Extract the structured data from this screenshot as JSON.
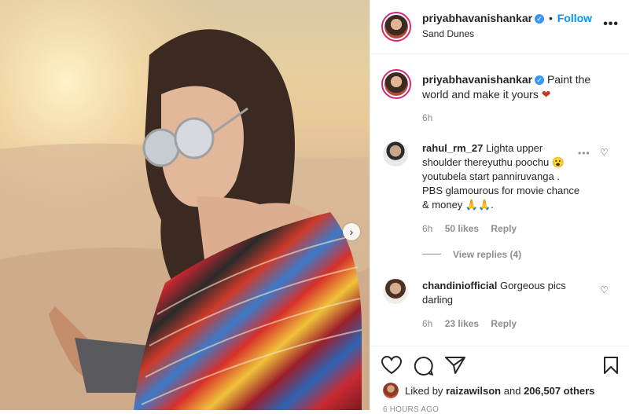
{
  "header": {
    "username": "priyabhavanishankar",
    "verified_icon": "✓",
    "separator": "•",
    "follow_label": "Follow",
    "location": "Sand Dunes",
    "more_icon": "•••"
  },
  "caption": {
    "username": "priyabhavanishankar",
    "text": "Paint the world and make it yours",
    "heart": "❤",
    "time": "6h"
  },
  "comments": [
    {
      "username": "rahul_rm_27",
      "lines": [
        "Lighta upper",
        "shoulder thereyuthu poochu 😮",
        "youtubela start panniruvanga .",
        "PBS glamourous for movie chance",
        "& money 🙏🙏."
      ],
      "time": "6h",
      "likes": "50 likes",
      "reply": "Reply",
      "view_replies": "View replies (4)"
    },
    {
      "username": "chandiniofficial",
      "lines": [
        "Gorgeous pics",
        "darling"
      ],
      "time": "6h",
      "likes": "23 likes",
      "reply": "Reply"
    }
  ],
  "footer": {
    "liked_by_prefix": "Liked by",
    "liked_user": "raizawilson",
    "liked_and": "and",
    "liked_count": "206,507 others",
    "timestamp": "6 HOURS AGO"
  },
  "icons": {
    "next": "›"
  },
  "colors": {
    "accent": "#0095f6",
    "heart": "#ed4956",
    "verified": "#3897f0"
  }
}
